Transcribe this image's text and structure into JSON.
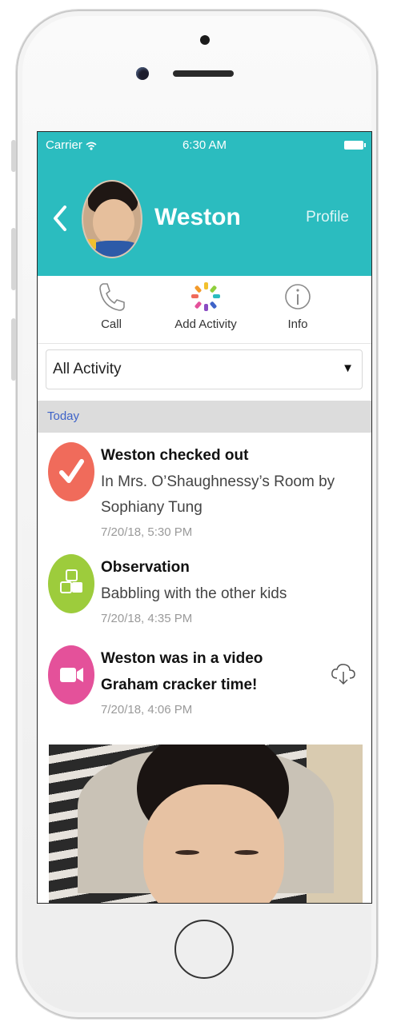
{
  "status_bar": {
    "carrier": "Carrier",
    "time": "6:30 AM"
  },
  "header": {
    "child_name": "Weston",
    "profile_link": "Profile"
  },
  "actions": [
    {
      "label": "Call",
      "icon": "phone-icon"
    },
    {
      "label": "Add Activity",
      "icon": "add-activity-icon"
    },
    {
      "label": "Info",
      "icon": "info-icon"
    }
  ],
  "filter": {
    "selected": "All Activity"
  },
  "section": {
    "label": "Today"
  },
  "feed": [
    {
      "title": "Weston checked out",
      "description": "In Mrs. O’Shaughnessy’s Room by Sophiany Tung",
      "date": "7/20/18, 5:30 PM",
      "icon": "checkmark-icon",
      "color": "#f06b5b"
    },
    {
      "title": "Observation",
      "description": "Babbling with the other kids",
      "date": "7/20/18, 4:35 PM",
      "icon": "blocks-icon",
      "color": "#9dcc3c"
    },
    {
      "title": "Weston was in a video",
      "description": "Graham cracker time!",
      "date": "7/20/18, 4:06 PM",
      "icon": "video-camera-icon",
      "color": "#e4519a",
      "download_icon": "cloud-download-icon"
    }
  ],
  "colors": {
    "header": "#2bbcbf",
    "section_label": "#3e63c8"
  }
}
